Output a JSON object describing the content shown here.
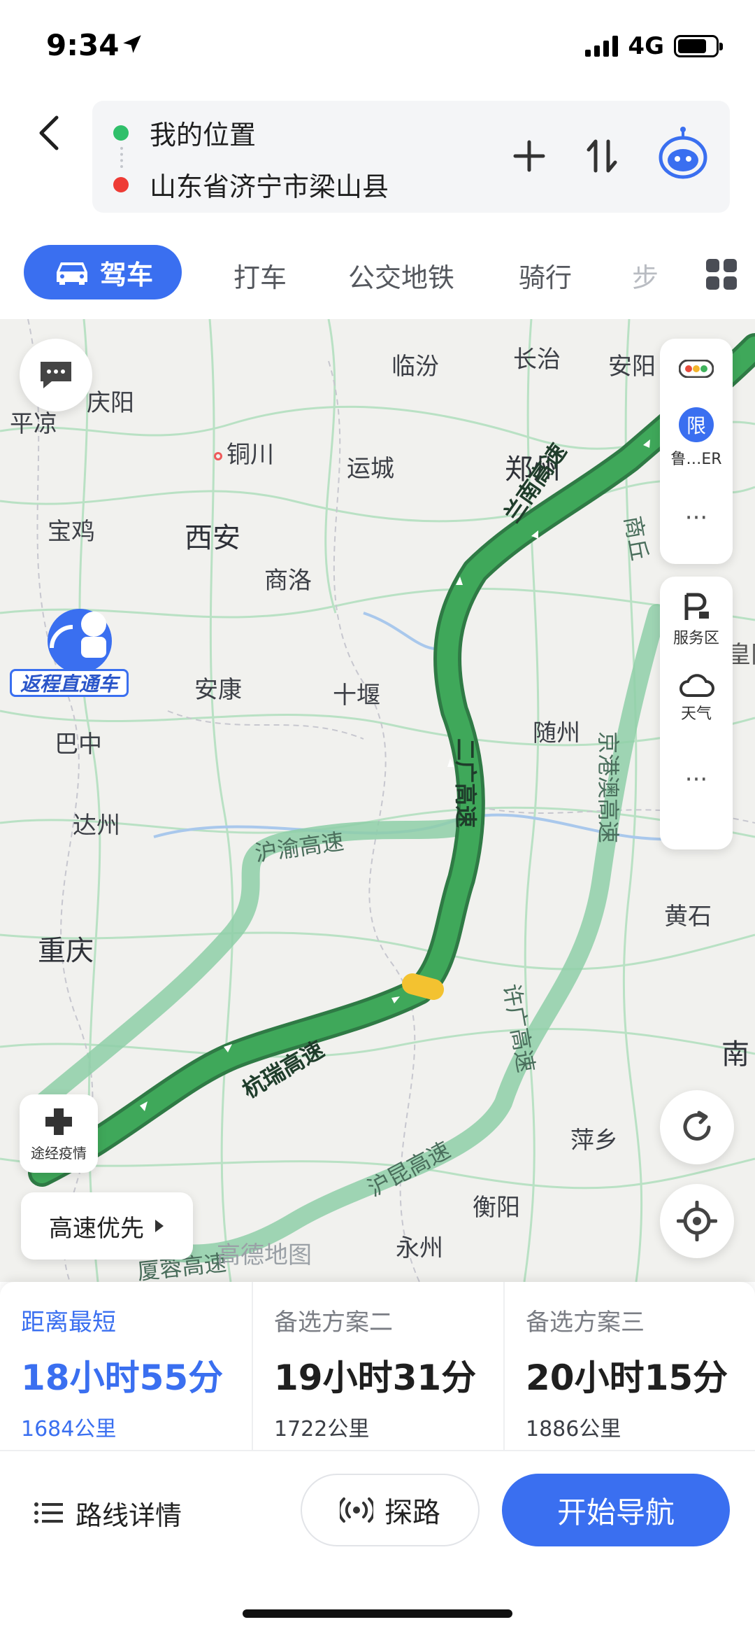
{
  "status": {
    "time": "9:34",
    "network": "4G"
  },
  "route": {
    "origin": "我的位置",
    "destination": "山东省济宁市梁山县"
  },
  "tabs": {
    "active": "驾车",
    "items": [
      "打车",
      "公交地铁",
      "骑行",
      "步"
    ]
  },
  "map": {
    "cities": [
      "庆阳",
      "平凉",
      "铜川",
      "临汾",
      "长治",
      "安阳",
      "宝鸡",
      "西安",
      "运城",
      "郑州",
      "商洛",
      "安康",
      "十堰",
      "巴中",
      "随州",
      "达州",
      "重庆",
      "黄石",
      "衡阳",
      "永州",
      "萍乡",
      "南"
    ],
    "roads": {
      "main1": "兰南高速",
      "main2": "二广高速",
      "main3": "杭瑞高速",
      "alt1": "沪渝高速",
      "alt2": "京港澳高速",
      "alt3": "许广高速",
      "alt4": "沪昆高速",
      "alt5": "厦蓉高速",
      "alt6": "商丘"
    },
    "promo": "返程直通车",
    "epidemic": "途经疫情",
    "preference": "高速优先",
    "restrict_label": "限",
    "plate": "鲁…ER",
    "service_area": "服务区",
    "weather": "天气",
    "more": "···",
    "watermark": "高德地图",
    "edge_label": "皇冈"
  },
  "options": [
    {
      "label": "距离最短",
      "time": "18小时55分",
      "distance": "1684公里",
      "selected": true
    },
    {
      "label": "备选方案二",
      "time": "19小时31分",
      "distance": "1722公里",
      "selected": false
    },
    {
      "label": "备选方案三",
      "time": "20小时15分",
      "distance": "1886公里",
      "selected": false
    }
  ],
  "actions": {
    "details": "路线详情",
    "explore": "探路",
    "navigate": "开始导航"
  },
  "colors": {
    "accent": "#3a6ff0",
    "route_green": "#3fa85a",
    "origin_dot": "#2fbf6a",
    "dest_dot": "#ee3b35"
  }
}
